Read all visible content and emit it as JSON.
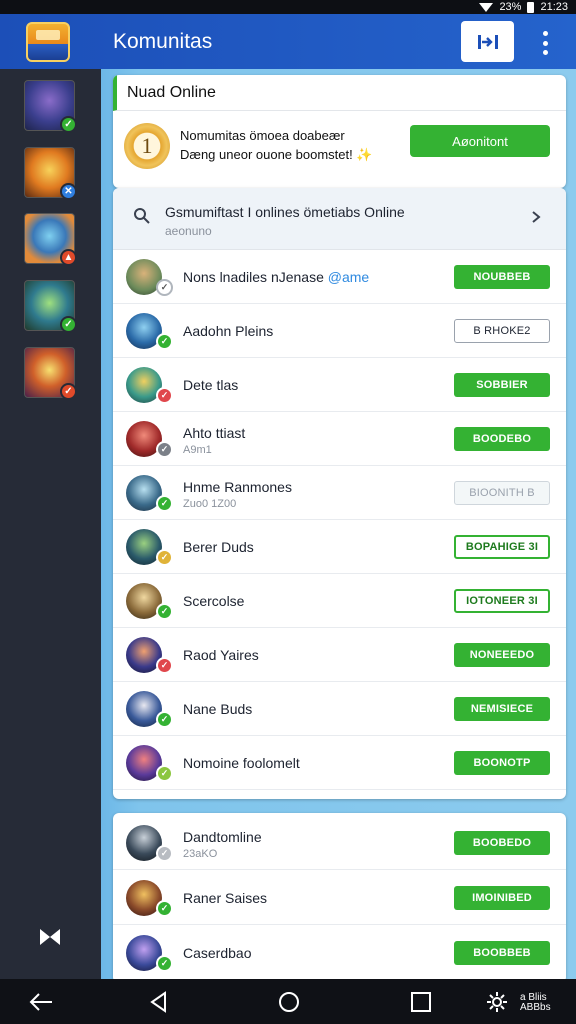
{
  "status_bar": {
    "battery": "23%",
    "time": "21:23"
  },
  "header": {
    "title": "Komunitas",
    "colors": {
      "bar": "#1c4fb8",
      "accent": "#34b233"
    }
  },
  "sidebar": {
    "games": [
      {
        "icon": "hero-portrait-1",
        "badge": "check-icon",
        "badge_color": "#34b233"
      },
      {
        "icon": "hero-portrait-2",
        "badge": "swords-icon",
        "badge_color": "#2f7fe0"
      },
      {
        "icon": "hero-portrait-3",
        "badge": "fire-icon",
        "badge_color": "#e04a2a"
      },
      {
        "icon": "hero-portrait-4",
        "badge": "check-icon",
        "badge_color": "#34b233"
      },
      {
        "icon": "hero-portrait-5",
        "badge": "check-icon",
        "badge_color": "#e04a2a"
      }
    ]
  },
  "now_online": {
    "title": "Nuad Online",
    "medal_number": "1",
    "line1": "Nomumitas ömoea doabeær",
    "line2": "Dæng uneor ouone boomstet!",
    "line2_emoji": "✨",
    "button": "Aøonitont"
  },
  "search_row": {
    "title": "Gsmumiftast I onlines ömetiabs Online",
    "subtitle": "aeonuno"
  },
  "friends": [
    {
      "name": "Nons lnadiles nJenase",
      "tag": "@ame",
      "sub": "",
      "button": "NOUBBEB",
      "style": "solid",
      "badge_color": "#ffffff"
    },
    {
      "name": "Aadohn Pleins",
      "tag": "",
      "sub": "",
      "button": "B RHOKE2",
      "style": "outline",
      "badge_color": "#34b233"
    },
    {
      "name": "Dete tlas",
      "tag": "",
      "sub": "",
      "button": "SOBBIER",
      "style": "solid",
      "badge_color": "#e0474c"
    },
    {
      "name": "Ahto ttiast",
      "tag": "",
      "sub": "A9m1",
      "button": "BOODEBO",
      "style": "solid",
      "badge_color": "#7b8088"
    },
    {
      "name": "Hnme Ranmones",
      "tag": "",
      "sub": "Zuo0 1Z00",
      "button": "BIOONITH B",
      "style": "faded",
      "badge_color": "#34b233"
    },
    {
      "name": "Berer Duds",
      "tag": "",
      "sub": "",
      "button": "BOPAHIGE 3I",
      "style": "outline-green",
      "badge_color": "#e0b338"
    },
    {
      "name": "Scercolse",
      "tag": "",
      "sub": "",
      "button": "IOTONEER 3I",
      "style": "outline-green",
      "badge_color": "#34b233"
    },
    {
      "name": "Raod Yaires",
      "tag": "",
      "sub": "",
      "button": "NONEEEDO",
      "style": "solid",
      "badge_color": "#e0474c"
    },
    {
      "name": "Nane Buds",
      "tag": "",
      "sub": "",
      "button": "NEMISIECE",
      "style": "solid",
      "badge_color": "#34b233"
    },
    {
      "name": "Nomoine foolomelt",
      "tag": "",
      "sub": "",
      "button": "BOONOTP",
      "style": "solid",
      "badge_color": "#8cc63f"
    }
  ],
  "friends2": [
    {
      "name": "Dandtomline",
      "sub": "23aKO",
      "button": "BOOBEDO",
      "style": "solid",
      "badge_color": "#b8bcc2"
    },
    {
      "name": "Raner Saises",
      "sub": "",
      "button": "IMOINIBED",
      "style": "solid",
      "badge_color": "#34b233"
    },
    {
      "name": "Caserdbao",
      "sub": "",
      "button": "BOOBBEB",
      "style": "solid",
      "badge_color": "#34b233"
    }
  ],
  "navbar": {
    "corner_label_1": "a Bliis",
    "corner_label_2": "ABBbs"
  }
}
